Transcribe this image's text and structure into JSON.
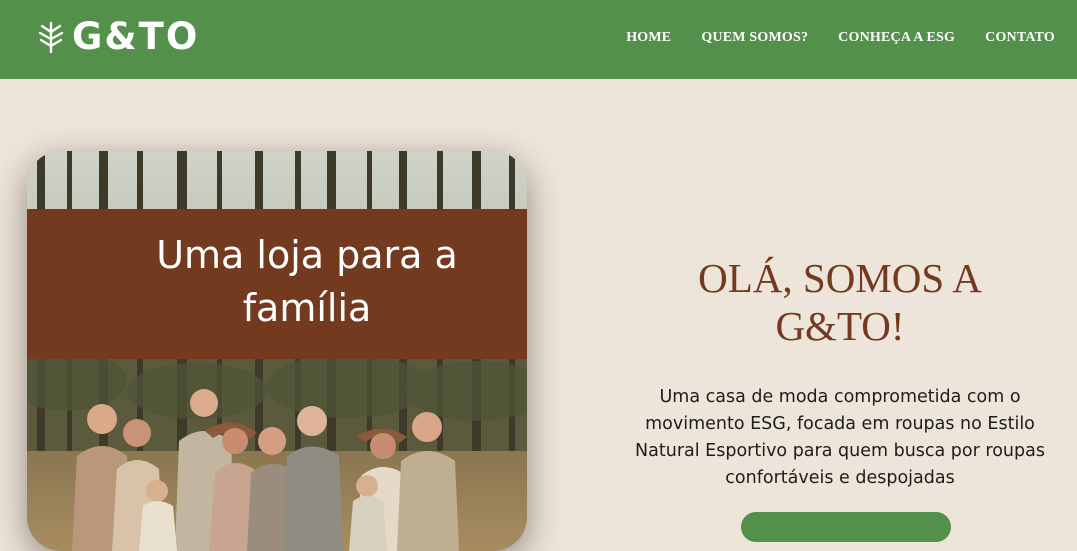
{
  "header": {
    "logo_text": "G&TO",
    "logo_icon": "leaf-branch-icon",
    "nav": [
      "HOME",
      "QUEM SOMOS?",
      "CONHEÇA A ESG",
      "CONTATO"
    ],
    "bar_color": "#52904b"
  },
  "hero": {
    "banner_title": "Uma loja para a família",
    "banner_color": "#733a1f",
    "title": "OLÁ, SOMOS A G&TO!",
    "title_color": "#733a1f",
    "description": "Uma casa de moda comprometida com o movimento ESG, focada em roupas no Estilo Natural Esportivo para quem busca por roupas confortáveis e despojadas"
  },
  "page": {
    "background": "#ede4da"
  }
}
